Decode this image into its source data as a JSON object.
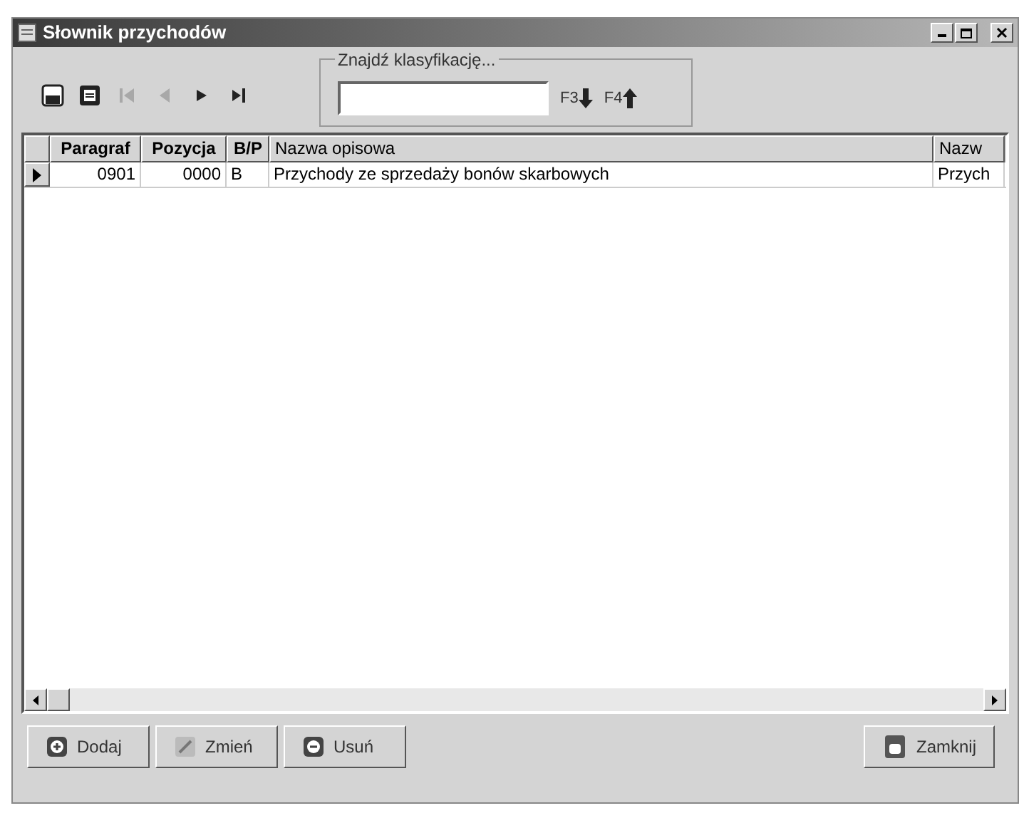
{
  "window": {
    "title": "Słownik przychodów"
  },
  "toolbar": [
    {
      "kind": "save",
      "disabled": false
    },
    {
      "kind": "doc",
      "disabled": false
    },
    {
      "kind": "first",
      "disabled": true
    },
    {
      "kind": "prev",
      "disabled": true
    },
    {
      "kind": "next",
      "disabled": false
    },
    {
      "kind": "last",
      "disabled": false
    }
  ],
  "search": {
    "label": "Znajdź klasyfikację...",
    "next_key": "F3",
    "prev_key": "F4"
  },
  "table": {
    "columns": [
      "Paragraf",
      "Pozycja",
      "B/P",
      "Nazwa opisowa",
      "Nazw"
    ],
    "rows": [
      {
        "selected": true,
        "cells": [
          "0901",
          "0000",
          "B",
          "Przychody ze sprzedaży bonów skarbowych",
          "Przych"
        ]
      }
    ]
  },
  "buttons": [
    {
      "kind": "add",
      "label": "Dodaj"
    },
    {
      "kind": "edit",
      "label": "Zmień"
    },
    {
      "kind": "delete",
      "label": "Usuń"
    },
    {
      "kind": "close",
      "label": "Zamknij"
    }
  ]
}
